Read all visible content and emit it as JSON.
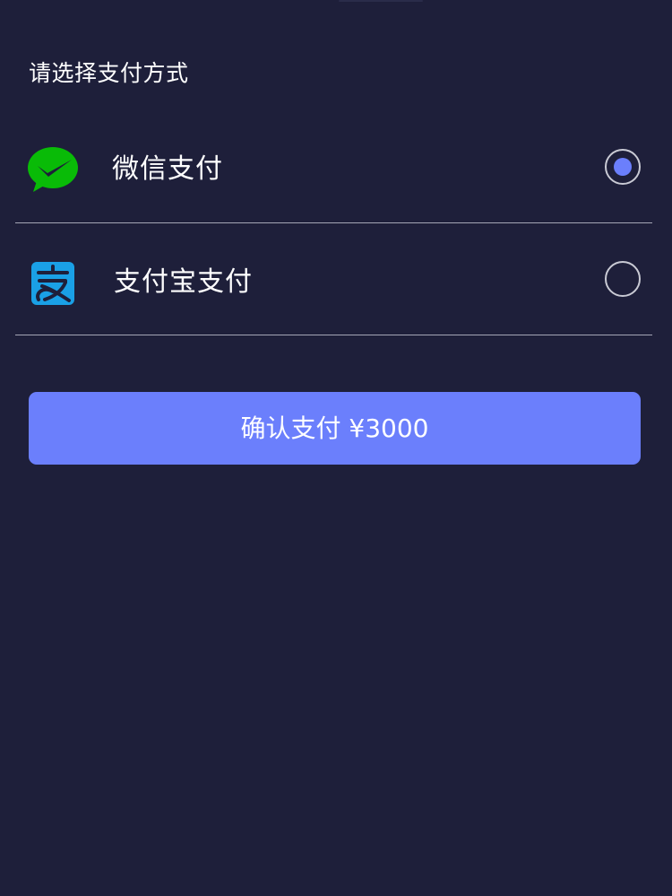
{
  "title": "请选择支付方式",
  "options": [
    {
      "label": "微信支付",
      "icon": "wechat-pay-icon",
      "selected": true
    },
    {
      "label": "支付宝支付",
      "icon": "alipay-icon",
      "selected": false
    }
  ],
  "confirm_button": {
    "label": "确认支付 ¥3000"
  },
  "colors": {
    "background": "#1e1f3a",
    "accent": "#6b7ffc",
    "wechat_green": "#09bb07",
    "alipay_blue": "#1aa0e6",
    "divider": "#a5a6b5"
  }
}
